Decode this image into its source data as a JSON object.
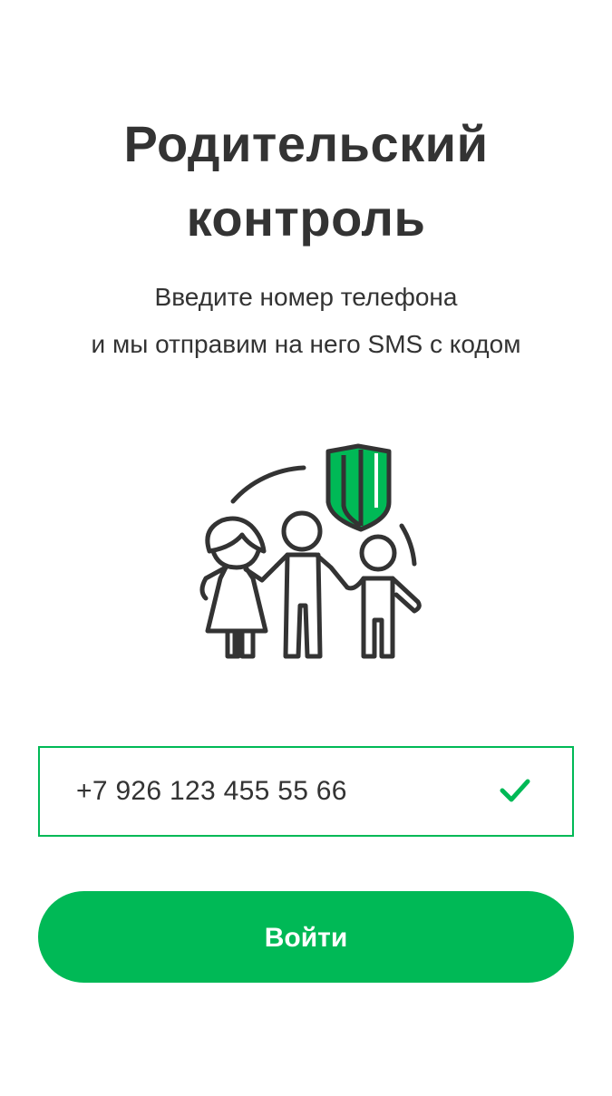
{
  "header": {
    "title_line1": "Родительский",
    "title_line2": "контроль",
    "subtitle_line1": "Введите номер телефона",
    "subtitle_line2": "и мы отправим на него SMS с кодом"
  },
  "illustration": {
    "icon": "family-shield-icon",
    "accent_color": "#00b956",
    "stroke_color": "#333333"
  },
  "phone_field": {
    "value": "+7 926 123 455 55 66",
    "valid_icon": "check-icon"
  },
  "login_button": {
    "label": "Войти",
    "color": "#00b956"
  }
}
